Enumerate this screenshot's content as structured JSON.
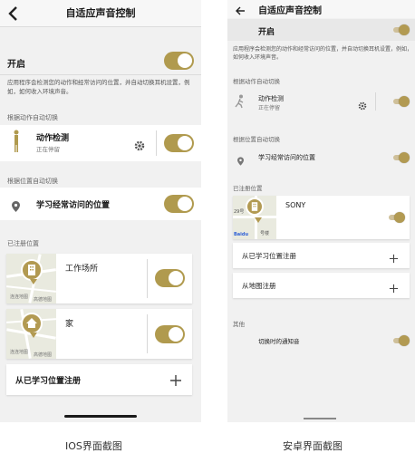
{
  "ios": {
    "title": "自适应声音控制",
    "enable_label": "开启",
    "description": "应用程序会检测您的动作和经常访问的位置，并自动切换耳机设置，例如，如何收入环境声音。",
    "section_motion": "根据动作自动切换",
    "motion_title": "动作检测",
    "motion_status": "正在停留",
    "section_location": "根据位置自动切换",
    "learn_locations": "学习经常访问的位置",
    "section_registered": "已注册位置",
    "place1_name": "工作场所",
    "place2_name": "家",
    "map_brand": "连连地图",
    "map_tag": "高德地图",
    "register_from_learned": "从已学习位置注册"
  },
  "android": {
    "title": "自适应声音控制",
    "enable_label": "开启",
    "description": "应用程序会检测您的动作和经常访问的位置，并自动切换耳机设置，例如，如何收入环境声音。",
    "section_motion": "根据动作自动切换",
    "motion_title": "动作检测",
    "motion_status": "正在停留",
    "section_location": "根据位置自动切换",
    "learn_locations": "学习经常访问的位置",
    "section_registered": "已注册位置",
    "place_name": "SONY",
    "map_street": "29号",
    "map_street2": "号楼",
    "map_brand": "Baidu",
    "register_from_learned": "从已学习位置注册",
    "register_from_map": "从地图注册",
    "section_other": "其他",
    "notification_sound": "切换时的通知音"
  },
  "captions": {
    "ios": "IOS界面截图",
    "android": "安卓界面截图"
  },
  "colors": {
    "accent": "#b09a4e",
    "background": "#f1f1f1",
    "card": "#ffffff"
  }
}
